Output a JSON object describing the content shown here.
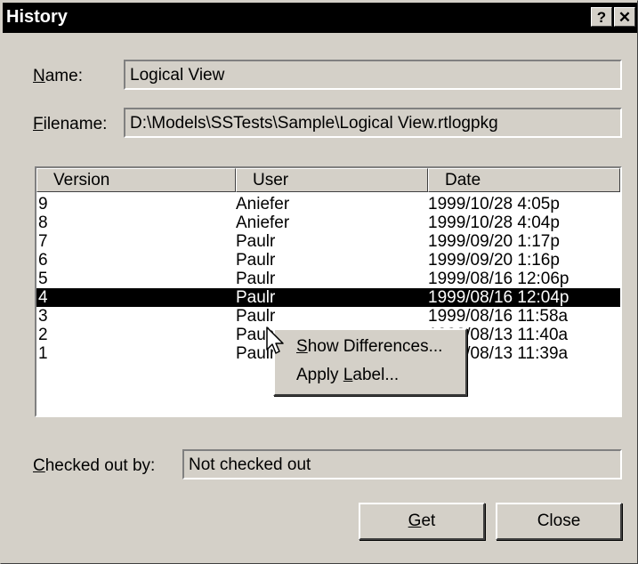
{
  "window": {
    "title": "History",
    "help_button": "?",
    "close_button": "✕"
  },
  "name_field": {
    "label_underlined": "N",
    "label_rest": "ame:",
    "value": "Logical View"
  },
  "filename_field": {
    "label_underlined": "F",
    "label_rest": "ilename:",
    "value": "D:\\Models\\SSTests\\Sample\\Logical View.rtlogpkg"
  },
  "history_list": {
    "columns": [
      "Version",
      "User",
      "Date"
    ],
    "rows": [
      {
        "version": "9",
        "user": "Aniefer",
        "date": "1999/10/28 4:05p"
      },
      {
        "version": "8",
        "user": "Aniefer",
        "date": "1999/10/28 4:04p"
      },
      {
        "version": "7",
        "user": "Paulr",
        "date": "1999/09/20 1:17p"
      },
      {
        "version": "6",
        "user": "Paulr",
        "date": "1999/09/20 1:16p"
      },
      {
        "version": "5",
        "user": "Paulr",
        "date": "1999/08/16 12:06p"
      },
      {
        "version": "4",
        "user": "Paulr",
        "date": "1999/08/16 12:04p",
        "selected": true
      },
      {
        "version": "3",
        "user": "Paulr",
        "date": "1999/08/16 11:58a"
      },
      {
        "version": "2",
        "user": "Paulr",
        "date": "1999/08/13 11:40a"
      },
      {
        "version": "1",
        "user": "Paulr",
        "date": "1999/08/13 11:39a"
      }
    ]
  },
  "context_menu": {
    "items": [
      {
        "underlined": "S",
        "rest": "how Differences..."
      },
      {
        "prefix": "Apply ",
        "underlined": "L",
        "rest": "abel..."
      }
    ]
  },
  "checked_out": {
    "label_underlined": "C",
    "label_rest": "hecked out by:",
    "value": "Not checked out"
  },
  "buttons": {
    "get": {
      "underlined": "G",
      "rest": "et"
    },
    "close": "Close"
  }
}
